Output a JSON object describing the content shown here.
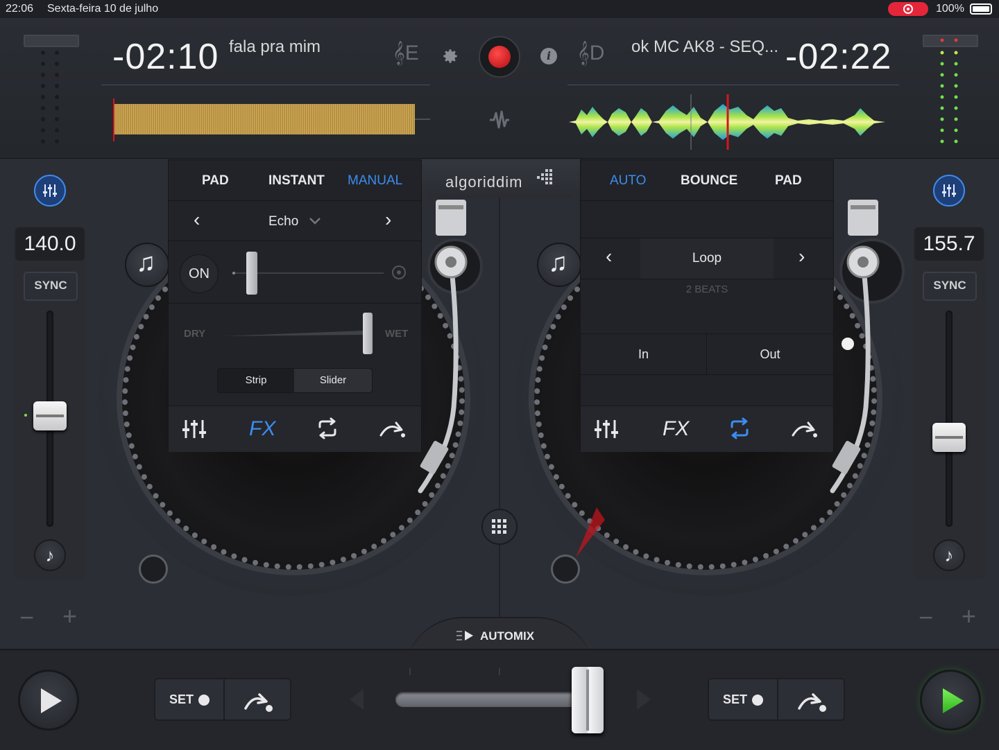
{
  "status_bar": {
    "time": "22:06",
    "date": "Sexta-feira 10 de julho",
    "battery": "100%"
  },
  "deck_left": {
    "remaining_time": "-02:10",
    "track_title": "fala pra mim",
    "key": "E",
    "bpm": "140.0",
    "sync_label": "SYNC",
    "fx_tabs": [
      "PAD",
      "INSTANT",
      "MANUAL"
    ],
    "fx_active_tab": "MANUAL",
    "effect_name": "Echo",
    "on_label": "ON",
    "dry_label": "DRY",
    "wet_label": "WET",
    "mode_buttons": [
      "Strip",
      "Slider"
    ],
    "pitch_level": 0.5,
    "fx_toolbar_active": "fx"
  },
  "deck_right": {
    "remaining_time": "-02:22",
    "track_title": "ok MC AK8 - SEQ...",
    "key": "D",
    "bpm": "155.7",
    "sync_label": "SYNC",
    "loop_tabs": [
      "AUTO",
      "BOUNCE",
      "PAD"
    ],
    "loop_active_tab": "AUTO",
    "loop_name": "Loop",
    "loop_length": "2 BEATS",
    "in_label": "In",
    "out_label": "Out",
    "pitch_level": 0.4,
    "fx_toolbar_active": "loop"
  },
  "center": {
    "brand": "algoriddim",
    "automix_label": "AUTOMIX"
  },
  "bottom": {
    "set_label_left": "SET",
    "set_label_right": "SET",
    "crossfader_position": 0.96
  },
  "colors": {
    "accent_blue": "#3d8cf0",
    "record_red": "#d8141e",
    "play_green": "#3ecf2b"
  }
}
